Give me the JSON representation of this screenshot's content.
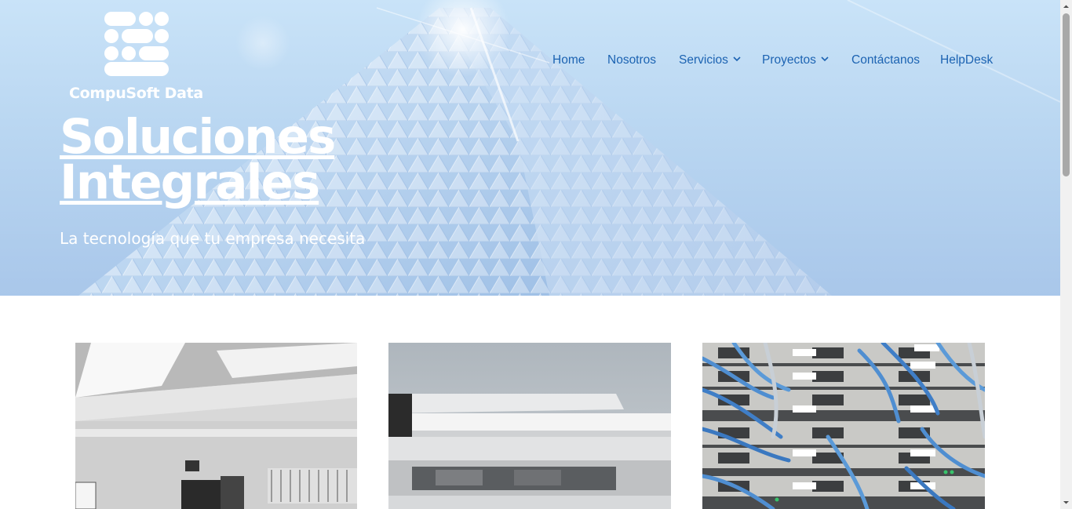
{
  "brand": {
    "name": "CompuSoft Data",
    "logo_icon": "dots-logo-icon"
  },
  "nav": {
    "items": [
      {
        "label": "Home",
        "has_dropdown": false
      },
      {
        "label": "Nosotros",
        "has_dropdown": false
      },
      {
        "label": "Servicios",
        "has_dropdown": true
      },
      {
        "label": "Proyectos",
        "has_dropdown": true
      },
      {
        "label": "Contáctanos",
        "has_dropdown": false
      },
      {
        "label": "HelpDesk",
        "has_dropdown": false
      }
    ],
    "color": "#1c63b2"
  },
  "hero": {
    "title_line1": "Soluciones",
    "title_line2": "Integrales",
    "subtitle": "La tecnología que tu empresa necesita"
  },
  "cards": [
    {
      "image": "office-interior-photo"
    },
    {
      "image": "printer-photo"
    },
    {
      "image": "server-rack-cables-photo"
    }
  ]
}
